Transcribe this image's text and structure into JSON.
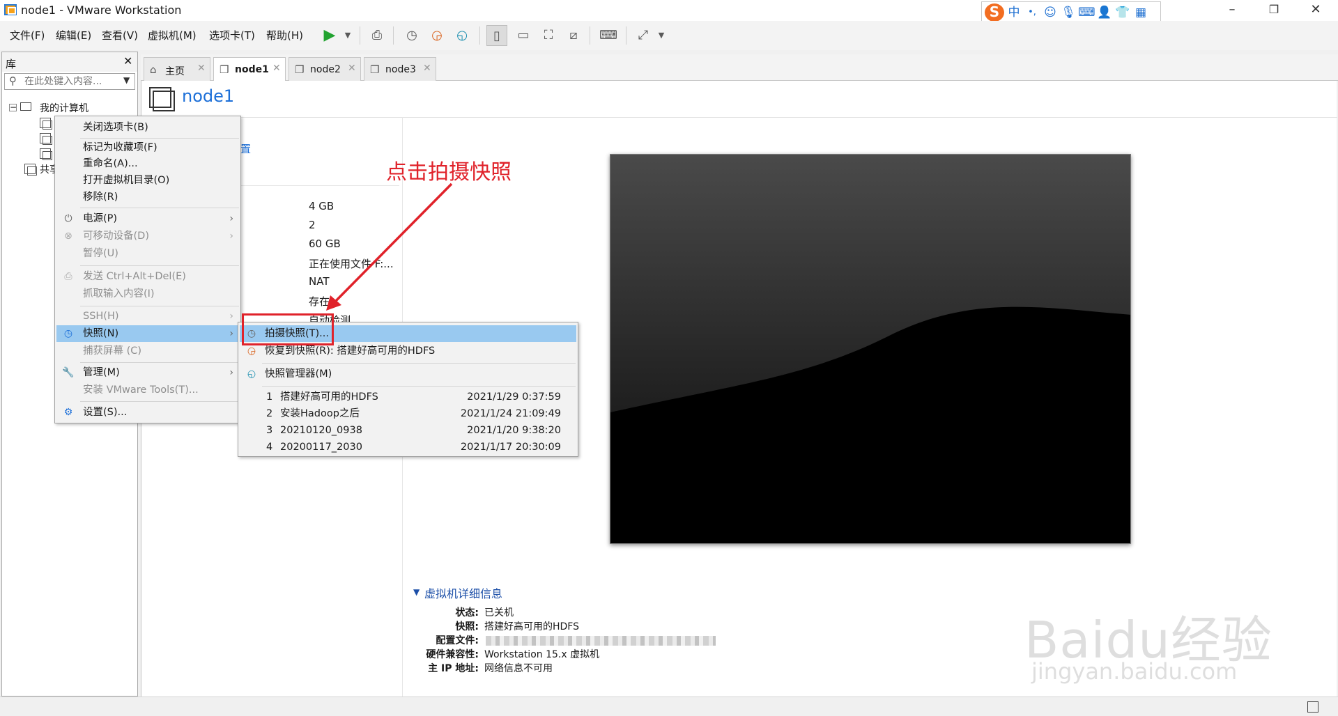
{
  "window": {
    "title": "node1 - VMware Workstation"
  },
  "ime": {
    "logo": "S",
    "mode": "中",
    "punct": "•,"
  },
  "menubar": {
    "items": [
      "文件(F)",
      "编辑(E)",
      "查看(V)",
      "虚拟机(M)",
      "选项卡(T)",
      "帮助(H)"
    ]
  },
  "library": {
    "title": "库",
    "search_placeholder": "在此处键入内容...",
    "tree": {
      "root": "我的计算机",
      "shared": "共享"
    }
  },
  "tabs": [
    {
      "label": "主页",
      "icon": "home-icon"
    },
    {
      "label": "node1",
      "icon": "vm-icon",
      "active": true
    },
    {
      "label": "node2",
      "icon": "vm-icon"
    },
    {
      "label": "node3",
      "icon": "vm-icon"
    }
  ],
  "main": {
    "title": "node1",
    "settings_link_fragment": "置",
    "hardware_values": [
      "4 GB",
      "2",
      "60 GB",
      "正在使用文件 F:...",
      "NAT",
      "存在",
      "自动检测"
    ],
    "hardware_label_fragment": ")"
  },
  "context_menu": {
    "items": [
      {
        "label": "关闭选项卡(B)",
        "enabled": true
      },
      {
        "label": "标记为收藏项(F)",
        "enabled": true
      },
      {
        "label": "重命名(A)...",
        "enabled": true
      },
      {
        "label": "打开虚拟机目录(O)",
        "enabled": true
      },
      {
        "label": "移除(R)",
        "enabled": true
      },
      {
        "label": "电源(P)",
        "enabled": true,
        "submenu": true,
        "icon": "power-icon"
      },
      {
        "label": "可移动设备(D)",
        "enabled": false,
        "submenu": true,
        "icon": "removable-device-icon"
      },
      {
        "label": "暂停(U)",
        "enabled": false
      },
      {
        "label": "发送 Ctrl+Alt+Del(E)",
        "enabled": false,
        "icon": "keyboard-icon"
      },
      {
        "label": "抓取输入内容(I)",
        "enabled": false
      },
      {
        "label": "SSH(H)",
        "enabled": false,
        "submenu": true
      },
      {
        "label": "快照(N)",
        "enabled": true,
        "submenu": true,
        "highlighted": true,
        "icon": "snapshot-icon"
      },
      {
        "label": "捕获屏幕 (C)",
        "enabled": false
      },
      {
        "label": "管理(M)",
        "enabled": true,
        "submenu": true,
        "icon": "wrench-icon"
      },
      {
        "label": "安装 VMware Tools(T)...",
        "enabled": false
      },
      {
        "label": "设置(S)...",
        "enabled": true,
        "icon": "settings-icon"
      }
    ]
  },
  "snapshot_submenu": {
    "take": "拍摄快照(T)...",
    "revert": "恢复到快照(R): 搭建好高可用的HDFS",
    "manager": "快照管理器(M)",
    "snapshots": [
      {
        "num": "1",
        "name": "搭建好高可用的HDFS",
        "date": "2021/1/29 0:37:59"
      },
      {
        "num": "2",
        "name": "安装Hadoop之后",
        "date": "2021/1/24 21:09:49"
      },
      {
        "num": "3",
        "name": "20210120_0938",
        "date": "2021/1/20 9:38:20"
      },
      {
        "num": "4",
        "name": "20200117_2030",
        "date": "2021/1/17 20:30:09"
      }
    ]
  },
  "annotation": {
    "text": "点击拍摄快照",
    "color": "#e0222a"
  },
  "details": {
    "title": "虚拟机详细信息",
    "rows": [
      {
        "label": "状态:",
        "value": "已关机"
      },
      {
        "label": "快照:",
        "value": "搭建好高可用的HDFS"
      },
      {
        "label": "配置文件:",
        "value": ""
      },
      {
        "label": "硬件兼容性:",
        "value": "Workstation 15.x 虚拟机"
      },
      {
        "label": "主 IP 地址:",
        "value": "网络信息不可用"
      }
    ]
  },
  "watermark": {
    "brand": "Baidu经验",
    "url": "jingyan.baidu.com"
  },
  "colors": {
    "accent": "#1c6fd8",
    "menu_highlight": "#99c9f0",
    "annotation": "#e0222a"
  }
}
